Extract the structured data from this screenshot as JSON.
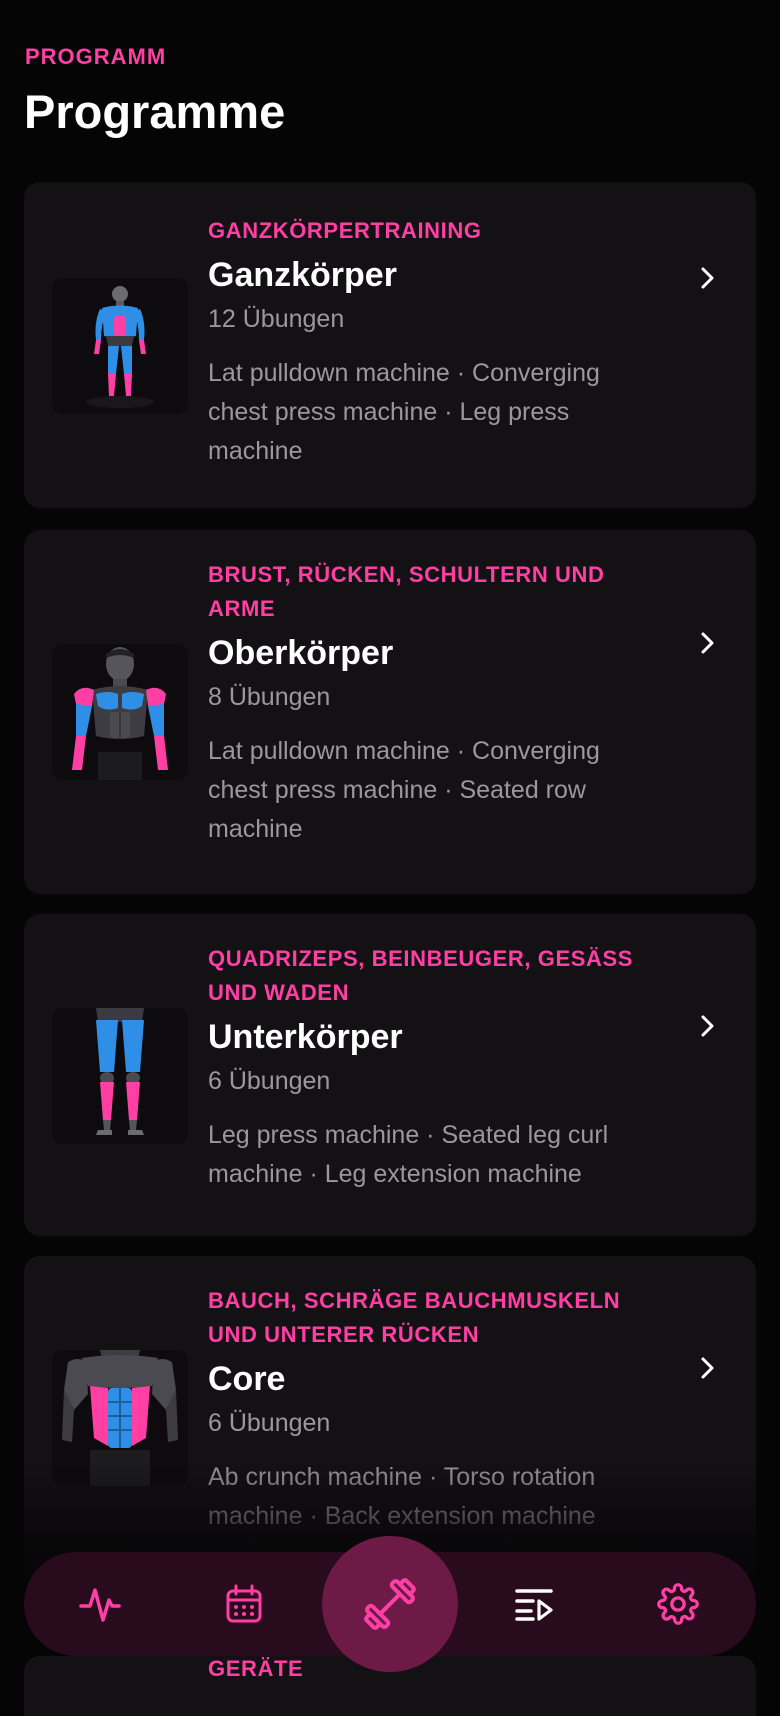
{
  "header": {
    "eyebrow": "PROGRAMM",
    "title": "Programme"
  },
  "programs": [
    {
      "category": "GANZKÖRPERTRAINING",
      "name": "Ganzkörper",
      "count": "12 Übungen",
      "exercises": "Lat pulldown machine · Converging chest press machine · Leg press machine"
    },
    {
      "category": "BRUST, RÜCKEN, SCHULTERN UND ARME",
      "name": "Oberkörper",
      "count": "8 Übungen",
      "exercises": "Lat pulldown machine · Converging chest press machine · Seated row machine"
    },
    {
      "category": "QUADRIZEPS, BEINBEUGER, GESÄSS UND WADEN",
      "name": "Unterkörper",
      "count": "6 Übungen",
      "exercises": "Leg press machine · Seated leg curl machine · Leg extension machine"
    },
    {
      "category": "BAUCH, SCHRÄGE BAUCHMUSKELN UND UNTERER RÜCKEN",
      "name": "Core",
      "count": "6 Übungen",
      "exercises": "Ab crunch machine · Torso rotation machine · Back extension machine"
    }
  ],
  "peek": {
    "category": "GERÄTE"
  },
  "tabbar": {
    "items": [
      "activity-icon",
      "calendar-icon",
      "dumbbell-icon",
      "playlist-icon",
      "gear-icon"
    ],
    "active": "dumbbell-icon"
  },
  "colors": {
    "accent": "#ff3fa4",
    "background": "#060506",
    "card": "#141115",
    "muted_text": "#9c979e",
    "muscle_blue": "#2f8fe6",
    "muscle_pink": "#ff3fa4"
  }
}
